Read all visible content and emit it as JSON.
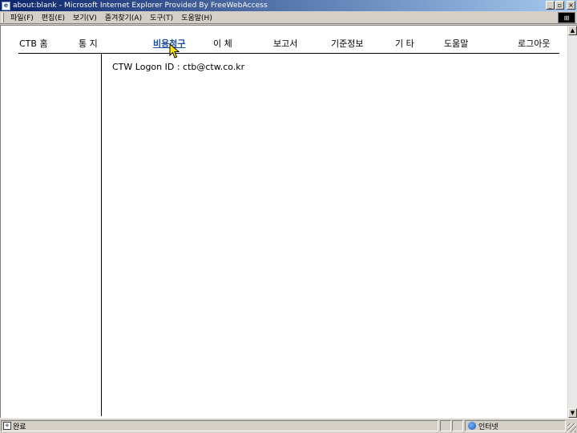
{
  "window": {
    "title": "about:blank - Microsoft Internet Explorer Provided By FreeWebAccess",
    "minimize": "_",
    "maximize": "▫",
    "close": "×"
  },
  "menubar": {
    "items": [
      "파일(F)",
      "편집(E)",
      "보기(V)",
      "즐겨찾기(A)",
      "도구(T)",
      "도움말(H)"
    ]
  },
  "page": {
    "nav": [
      {
        "label": "CTB 홈"
      },
      {
        "label": "통    지"
      },
      {
        "label": "비용청구"
      },
      {
        "label": "이    체"
      },
      {
        "label": "보고서"
      },
      {
        "label": "기준정보"
      },
      {
        "label": "기    타"
      },
      {
        "label": "도움말"
      },
      {
        "label": "로그아웃"
      }
    ],
    "logon_text": "CTW Logon ID : ctb@ctw.co.kr"
  },
  "statusbar": {
    "status_text": "완료",
    "zone_text": "인터넷"
  }
}
